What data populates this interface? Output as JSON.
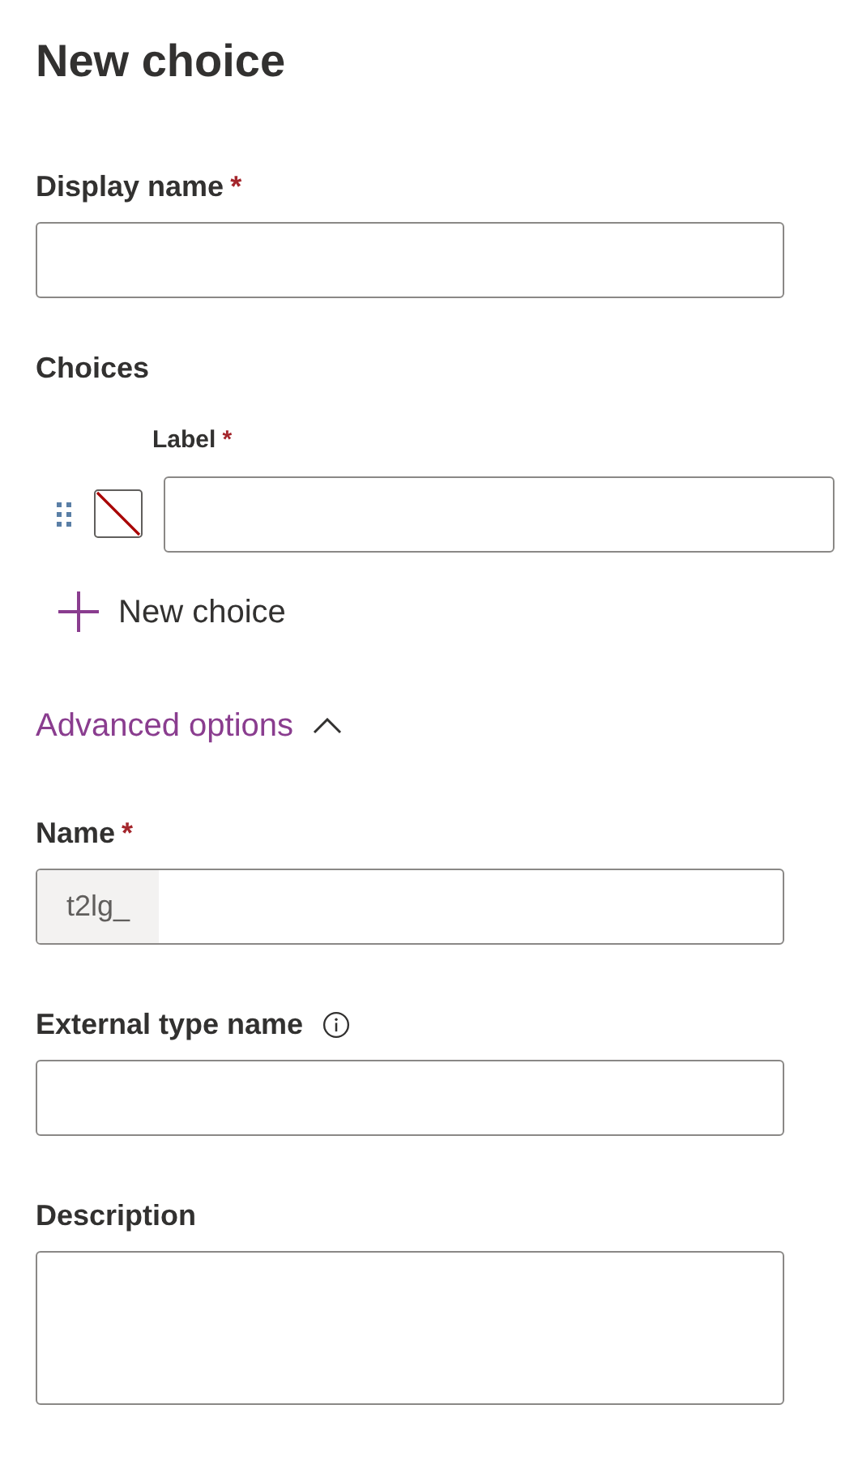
{
  "title": "New choice",
  "display_name": {
    "label": "Display name",
    "required_mark": "*"
  },
  "choices": {
    "heading": "Choices",
    "column_label": "Label",
    "required_mark": "*",
    "items": [
      {
        "color_set": false
      }
    ],
    "add_button": "New choice"
  },
  "advanced_options": {
    "label": "Advanced options",
    "expanded": true
  },
  "name_field": {
    "label": "Name",
    "required_mark": "*",
    "prefix": "t2lg_"
  },
  "external_type_name": {
    "label": "External type name"
  },
  "description": {
    "label": "Description"
  }
}
